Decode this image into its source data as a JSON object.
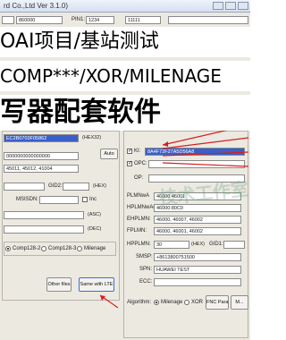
{
  "window": {
    "title": "rd Co.,Ltd Ver 3.1.0)"
  },
  "banners": {
    "line1": "OAI项目/基站测试",
    "line2": "COMP***/XOR/MILENAGE",
    "line3": "写器配套软件"
  },
  "top_row": {
    "field1": "860000",
    "pin1_label": "PIN1:",
    "pin1_value": "1234",
    "field3": "11111"
  },
  "left": {
    "hex32_value": "EC2B0703F05862",
    "hex32_tag": "(HEX32)",
    "auto_label": "Auto",
    "mid_value": "0000000000000000",
    "list_value": "45011, 45012, 41004",
    "gid2_label": "GID2:",
    "msisdn_label": "MSISDN:",
    "inc_label": "Inc",
    "hex_tag": "(HEX)",
    "asc_tag": "(ASC)",
    "dec_tag": "(DEC)",
    "algo_options": [
      "Comp128-2",
      "Comp128-3",
      "Milenage"
    ],
    "algo_selected": "Comp128-2",
    "other_files_button": "Other files",
    "same_with_lte_button": "Same with LTE"
  },
  "right": {
    "ki_label": "KI:",
    "ki_value": "8A4F72F27A5D56A8",
    "opc_label": "OPC:",
    "op_label": "OP:",
    "plmn_label": "PLMNwA",
    "plmn_value": "46000,46001",
    "hplmn_label": "HPLMNwAcT:",
    "hplmn_value": "46000:80C0",
    "ehplmn_label": "EHPLMN:",
    "ehplmn_value": "46000, 46007, 46002",
    "fplmn_label": "FPLMN:",
    "fplmn_value": "46000, 46001, 46002",
    "hpplmn_label": "HPPLMN:",
    "hpplmn_value": "30",
    "gid1_label": "GID1:",
    "smsp_label": "SMSP:",
    "smsp_value": "+8613800751500",
    "spn_label": "SPN:",
    "spn_value": "HUAWEI TEST",
    "ecc_label": "ECC:",
    "algorithm_label": "Algorithm:",
    "algo_options": [
      "Milenage",
      "XOR"
    ],
    "algo_selected": "Milenage",
    "fnc_button": "FNC Para",
    "extra_button": "M..."
  },
  "watermark": "技术工作室"
}
